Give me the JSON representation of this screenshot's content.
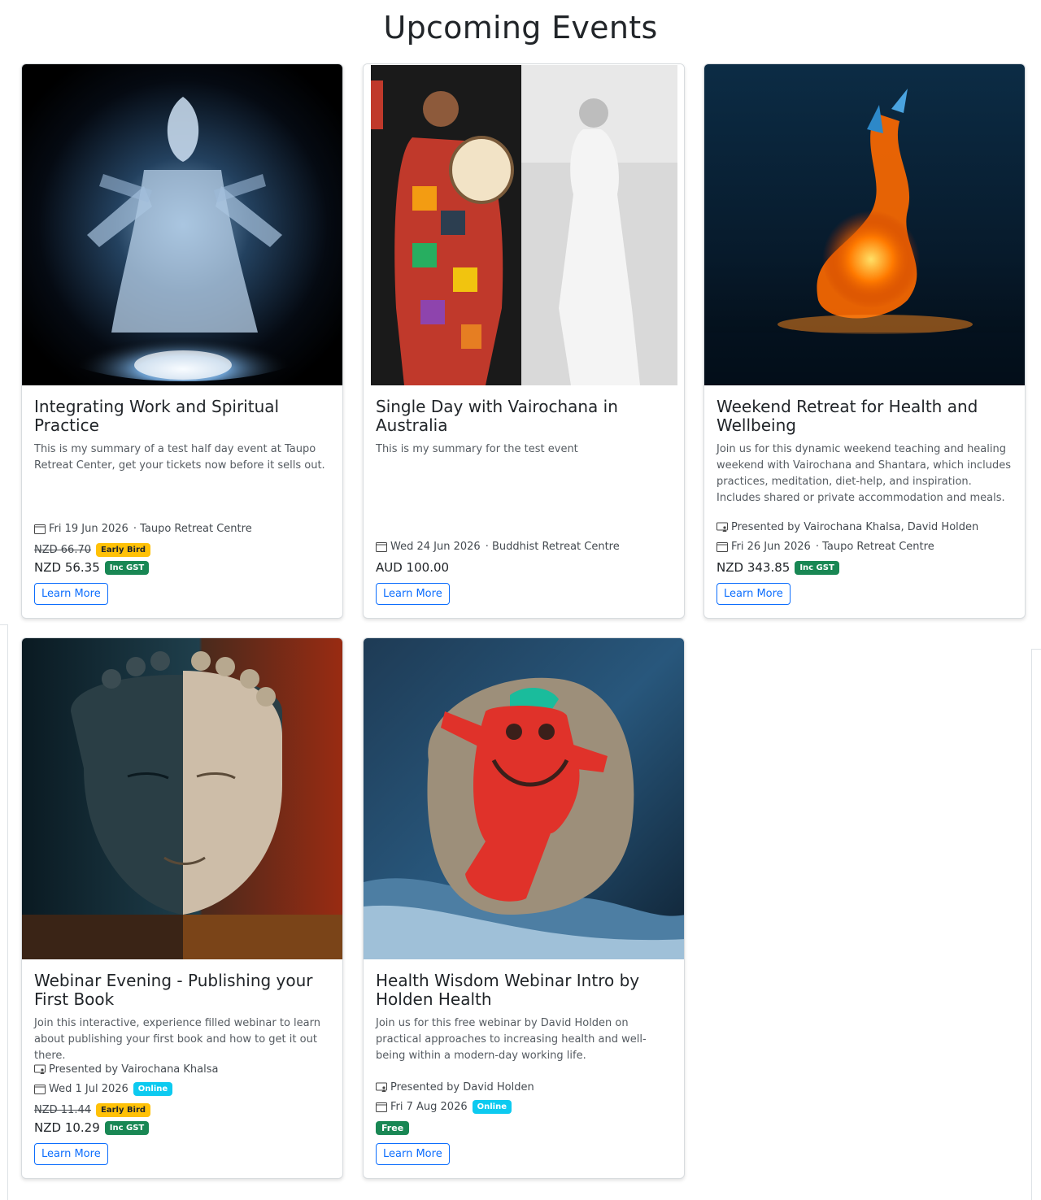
{
  "page": {
    "title": "Upcoming Events"
  },
  "events": [
    {
      "title": "Integrating Work and Spiritual Practice",
      "summary": "This is my summary of a test half day event at Taupo Retreat Center, get your tickets now before it sells out.",
      "presenter": "",
      "date": "Fri 19 Jun 2026",
      "venue": "· Taupo Retreat Centre",
      "old_price": "NZD 66.70",
      "early_badge": "Early Bird",
      "price": "NZD 56.35",
      "gst_badge": "Inc GST",
      "button": "Learn More",
      "image_icon": "goddess-image"
    },
    {
      "title": "Single Day with Vairochana in Australia",
      "summary": "This is my summary for the test event",
      "date": "Wed 24 Jun 2026",
      "venue": "· Buddhist Retreat Centre",
      "price": "AUD 100.00",
      "button": "Learn More",
      "image_icon": "drummer-image"
    },
    {
      "title": "Weekend Retreat for Health and Wellbeing",
      "summary": "Join us for this dynamic weekend teaching and healing weekend with Vairochana and Shantara, which includes practices, meditation, diet-help, and inspiration. Includes shared or private accommodation and meals.",
      "presenter": "Presented by Vairochana Khalsa, David Holden",
      "date": "Fri 26 Jun 2026",
      "venue": "· Taupo Retreat Centre",
      "price": "NZD 343.85",
      "gst_badge": "Inc GST",
      "button": "Learn More",
      "image_icon": "fire-water-image"
    },
    {
      "title": "Webinar Evening - Publishing your First Book",
      "summary": "Join this interactive, experience filled webinar to learn about publishing your first book and how to get it out there.",
      "presenter": "Presented by Vairochana Khalsa",
      "date": "Wed 1 Jul 2026",
      "online_badge": "Online",
      "old_price": "NZD 11.44",
      "early_badge": "Early Bird",
      "price": "NZD 10.29",
      "gst_badge": "Inc GST",
      "button": "Learn More",
      "image_icon": "buddha-image"
    },
    {
      "title": "Health Wisdom Webinar Intro by Holden Health",
      "summary": "Join us for this free webinar by David Holden on practical approaches to increasing health and well-being within a modern-day working life.",
      "presenter": "Presented by David Holden",
      "date": "Fri 7 Aug 2026",
      "online_badge": "Online",
      "free_badge": "Free",
      "button": "Learn More",
      "image_icon": "painted-rock-image"
    }
  ],
  "colors": {
    "primary": "#0d6efd",
    "warning": "#ffc107",
    "success": "#198754",
    "info": "#0dcaf0"
  }
}
